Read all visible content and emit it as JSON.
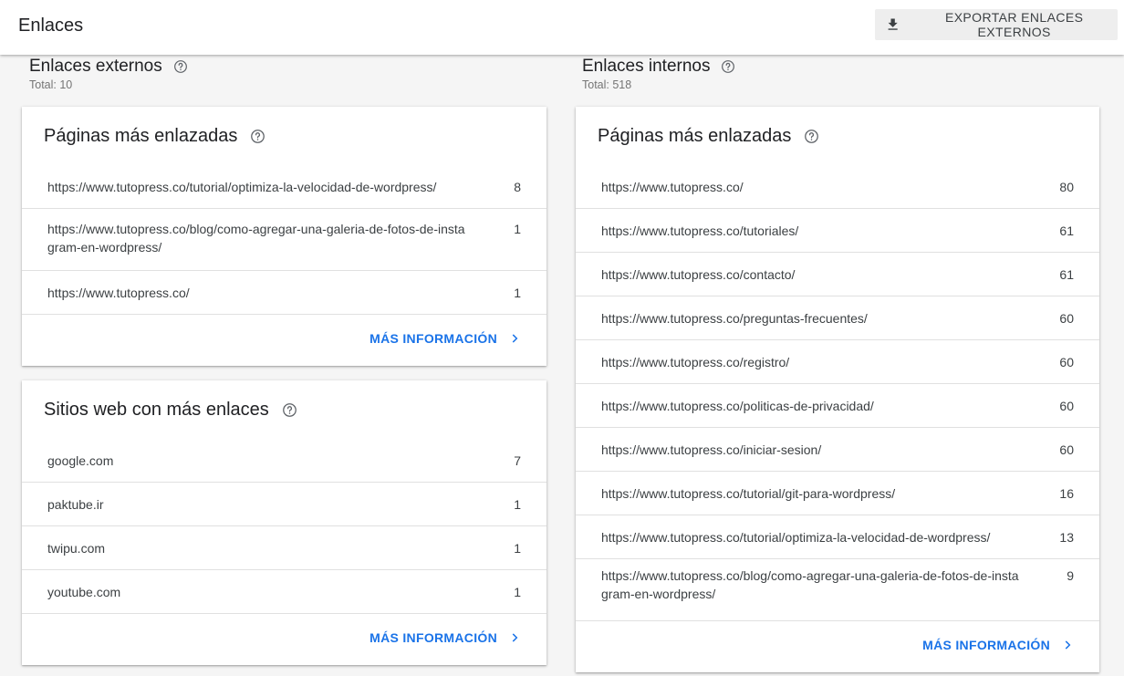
{
  "header": {
    "title": "Enlaces",
    "export_label": "EXPORTAR ENLACES EXTERNOS"
  },
  "external": {
    "heading": "Enlaces externos",
    "total": "Total: 10",
    "top_pages": {
      "title": "Páginas más enlazadas",
      "rows": [
        {
          "url": "https://www.tutopress.co/tutorial/optimiza-la-velocidad-de-wordpress/",
          "count": "8"
        },
        {
          "url": "https://www.tutopress.co/blog/como-agregar-una-galeria-de-fotos-de-instagram-en-wordpress/",
          "count": "1"
        },
        {
          "url": "https://www.tutopress.co/",
          "count": "1"
        }
      ],
      "more_label": "MÁS INFORMACIÓN"
    },
    "top_sites": {
      "title": "Sitios web con más enlaces",
      "rows": [
        {
          "url": "google.com",
          "count": "7"
        },
        {
          "url": "paktube.ir",
          "count": "1"
        },
        {
          "url": "twipu.com",
          "count": "1"
        },
        {
          "url": "youtube.com",
          "count": "1"
        }
      ],
      "more_label": "MÁS INFORMACIÓN"
    }
  },
  "internal": {
    "heading": "Enlaces internos",
    "total": "Total: 518",
    "top_pages": {
      "title": "Páginas más enlazadas",
      "rows": [
        {
          "url": "https://www.tutopress.co/",
          "count": "80"
        },
        {
          "url": "https://www.tutopress.co/tutoriales/",
          "count": "61"
        },
        {
          "url": "https://www.tutopress.co/contacto/",
          "count": "61"
        },
        {
          "url": "https://www.tutopress.co/preguntas-frecuentes/",
          "count": "60"
        },
        {
          "url": "https://www.tutopress.co/registro/",
          "count": "60"
        },
        {
          "url": "https://www.tutopress.co/politicas-de-privacidad/",
          "count": "60"
        },
        {
          "url": "https://www.tutopress.co/iniciar-sesion/",
          "count": "60"
        },
        {
          "url": "https://www.tutopress.co/tutorial/git-para-wordpress/",
          "count": "16"
        },
        {
          "url": "https://www.tutopress.co/tutorial/optimiza-la-velocidad-de-wordpress/",
          "count": "13"
        },
        {
          "url": "https://www.tutopress.co/blog/como-agregar-una-galeria-de-fotos-de-instagram-en-wordpress/",
          "count": "9"
        }
      ],
      "more_label": "MÁS INFORMACIÓN"
    }
  },
  "icons": {
    "export": "download-icon",
    "help": "help-circle-icon",
    "more": "chevron-right-icon"
  },
  "colors": {
    "link": "#1a73e8",
    "divider": "#e0e0e0",
    "background": "#f5f5f5"
  }
}
